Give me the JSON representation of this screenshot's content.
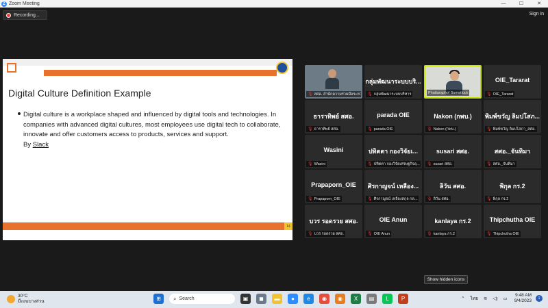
{
  "window": {
    "title": "Zoom Meeting",
    "controls": [
      "—",
      "☐",
      "✕"
    ]
  },
  "meeting": {
    "recording_label": "Recording...",
    "sign_in_label": "Sign in",
    "show_hidden_icons_label": "Show hidden icons"
  },
  "slide": {
    "title": "Digital Culture Definition Example",
    "body_text": "Digital culture is a workplace shaped and influenced by digital tools and technologies. In companies with advanced digital cultures, most employees use digital tech to collaborate, innovate and offer customers access to products, services and support.",
    "by_label": "By ",
    "link_text": "Slack",
    "page_number": "14"
  },
  "participants": [
    {
      "name": "",
      "label": "สศอ. สำนักความร่วมมือระหว่าง...",
      "has_video": true
    },
    {
      "name": "กลุ่มพัฒนาระบบบริ...",
      "label": "กลุ่มพัฒนาระบบบริหาร",
      "has_video": false
    },
    {
      "name": "",
      "label": "Phattaraphol Sumatluck",
      "has_video": true
    },
    {
      "name": "OIE_Tararat",
      "label": "OIE_Tararat",
      "has_video": false
    },
    {
      "name": "ธาราทิพย์ สศอ.",
      "label": "ธาราทิพย์ สศอ.",
      "has_video": false
    },
    {
      "name": "parada OIE",
      "label": "parada OIE",
      "has_video": false
    },
    {
      "name": "Nakon (กพบ.)",
      "label": "Nakon (กพบ.)",
      "has_video": false
    },
    {
      "name": "พิมพ์ขวัญ ลิมปโสภ...",
      "label": "พิมพ์ขวัญ ลิมปโสภา_สศอ.",
      "has_video": false
    },
    {
      "name": "Wasini",
      "label": "Wasini",
      "has_video": false
    },
    {
      "name": "ปทิตตา กองวิจัยเ...",
      "label": "ปทิตตา กองวิจัยเศรษฐกิจอุ...",
      "has_video": false
    },
    {
      "name": "susari สศอ.",
      "label": "susari สศอ.",
      "has_video": false
    },
    {
      "name": "สศอ._จันทิมา",
      "label": "สศอ._จันทิมา",
      "has_video": false
    },
    {
      "name": "Prapaporn_OIE",
      "label": "Prapaporn_OIE",
      "has_video": false
    },
    {
      "name": "ศิรกาญจน์ เหลือง...",
      "label": "ศิรกาญจน์ เหลืองสกุล กล...",
      "has_video": false
    },
    {
      "name": "ลิวัน สศอ.",
      "label": "ลิวัน สศอ.",
      "has_video": false
    },
    {
      "name": "พิกุล กร.2",
      "label": "พิกุล กร.2",
      "has_video": false
    },
    {
      "name": "บวร รอดรวย สศอ.",
      "label": "บวร รอดรวย สศอ.",
      "has_video": false
    },
    {
      "name": "OIE Anun",
      "label": "OIE Anun",
      "has_video": false
    },
    {
      "name": "kanlaya กร.2",
      "label": "kanlaya กร.2",
      "has_video": false
    },
    {
      "name": "Thipchutha OIE",
      "label": "Thipchutha OIE",
      "has_video": false
    }
  ],
  "taskbar": {
    "weather_temp": "30°C",
    "weather_desc": "มีเมฆบางส่วน",
    "search_placeholder": "Search",
    "language": "ไทย",
    "time": "9:48 AM",
    "date": "9/4/2023",
    "notification_count": "1"
  },
  "colors": {
    "accent_orange": "#e8722c",
    "tile_bg": "#2b2b2b",
    "active_speaker": "#c7e300",
    "mic_off": "#e53935"
  }
}
